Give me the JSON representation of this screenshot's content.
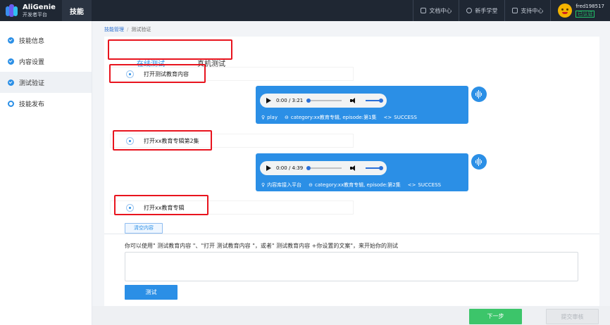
{
  "header": {
    "logo_title": "AliGenie",
    "logo_subtitle": "开发者平台",
    "nav_active": "技能",
    "links": [
      "文档中心",
      "新手学堂",
      "支持中心"
    ],
    "username": "fred198517",
    "verified": "已认证"
  },
  "sidebar": {
    "items": [
      {
        "label": "技能信息",
        "state": "done"
      },
      {
        "label": "内容设置",
        "state": "done"
      },
      {
        "label": "测试验证",
        "state": "current"
      },
      {
        "label": "技能发布",
        "state": "todo"
      }
    ]
  },
  "breadcrumb": {
    "parent": "技能管理",
    "current": "测试验证"
  },
  "tabs": [
    "在线测试",
    "真机测试"
  ],
  "conversation": [
    {
      "utterance": "打开测试教育内容",
      "audio_time": "0:00 / 3:21",
      "meta": [
        {
          "icon": "location-icon",
          "glyph": "♀",
          "text": "play"
        },
        {
          "icon": "category-icon",
          "glyph": "⊖",
          "text": "category:xx教育专辑, episode:第1集"
        },
        {
          "icon": "code-icon",
          "glyph": "<>",
          "text": "SUCCESS"
        }
      ]
    },
    {
      "utterance": "打开xx教育专辑第2集",
      "audio_time": "0:00 / 4:39",
      "meta": [
        {
          "icon": "location-icon",
          "glyph": "♀",
          "text": "内容库接入平台"
        },
        {
          "icon": "category-icon",
          "glyph": "⊖",
          "text": "category:xx教育专辑, episode:第2集"
        },
        {
          "icon": "code-icon",
          "glyph": "<>",
          "text": "SUCCESS"
        }
      ]
    },
    {
      "utterance": "打开xx教育专辑"
    }
  ],
  "test_area": {
    "clear_label": "清空内容",
    "hint": "你可以使用\" 测试教育内容 \"、\"打开 测试教育内容 \"，或者\" 测试教育内容 +你设置的文案\"，来开始你的测试",
    "input_value": "",
    "test_label": "测试"
  },
  "footer": {
    "next_label": "下一步",
    "submit_label": "提交审核"
  },
  "colors": {
    "accent": "#2b8fe6",
    "highlight_box": "#e8141e",
    "topbar": "#1f2733",
    "next_button": "#3cc56a"
  }
}
